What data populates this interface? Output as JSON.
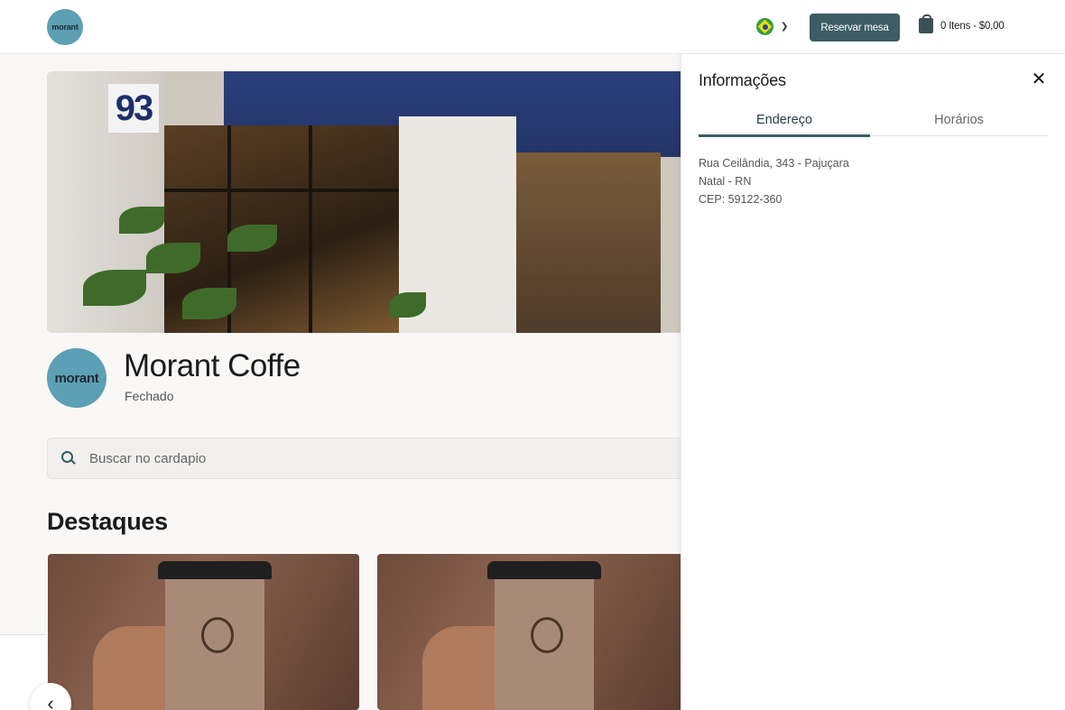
{
  "header": {
    "logo_text": "morant",
    "reserve_label": "Reservar mesa",
    "cart_label": "0 Itens - $0,00"
  },
  "hero": {
    "house_number": "93"
  },
  "store": {
    "logo_text": "morant",
    "name": "Morant Coffe",
    "status": "Fechado"
  },
  "search": {
    "placeholder": "Buscar no cardapio"
  },
  "featured": {
    "title": "Destaques"
  },
  "drawer": {
    "title": "Informações",
    "tabs": [
      {
        "label": "Endereço",
        "active": true
      },
      {
        "label": "Horários",
        "active": false
      }
    ],
    "address": {
      "line1": "Rua Ceilândia, 343 - Pajuçara",
      "line2": "Natal - RN",
      "line3": "CEP: 59122-360"
    }
  },
  "colors": {
    "primary": "#3d5c63",
    "logo_bg": "#5d9fb4",
    "awning": "#2c3f7a"
  }
}
